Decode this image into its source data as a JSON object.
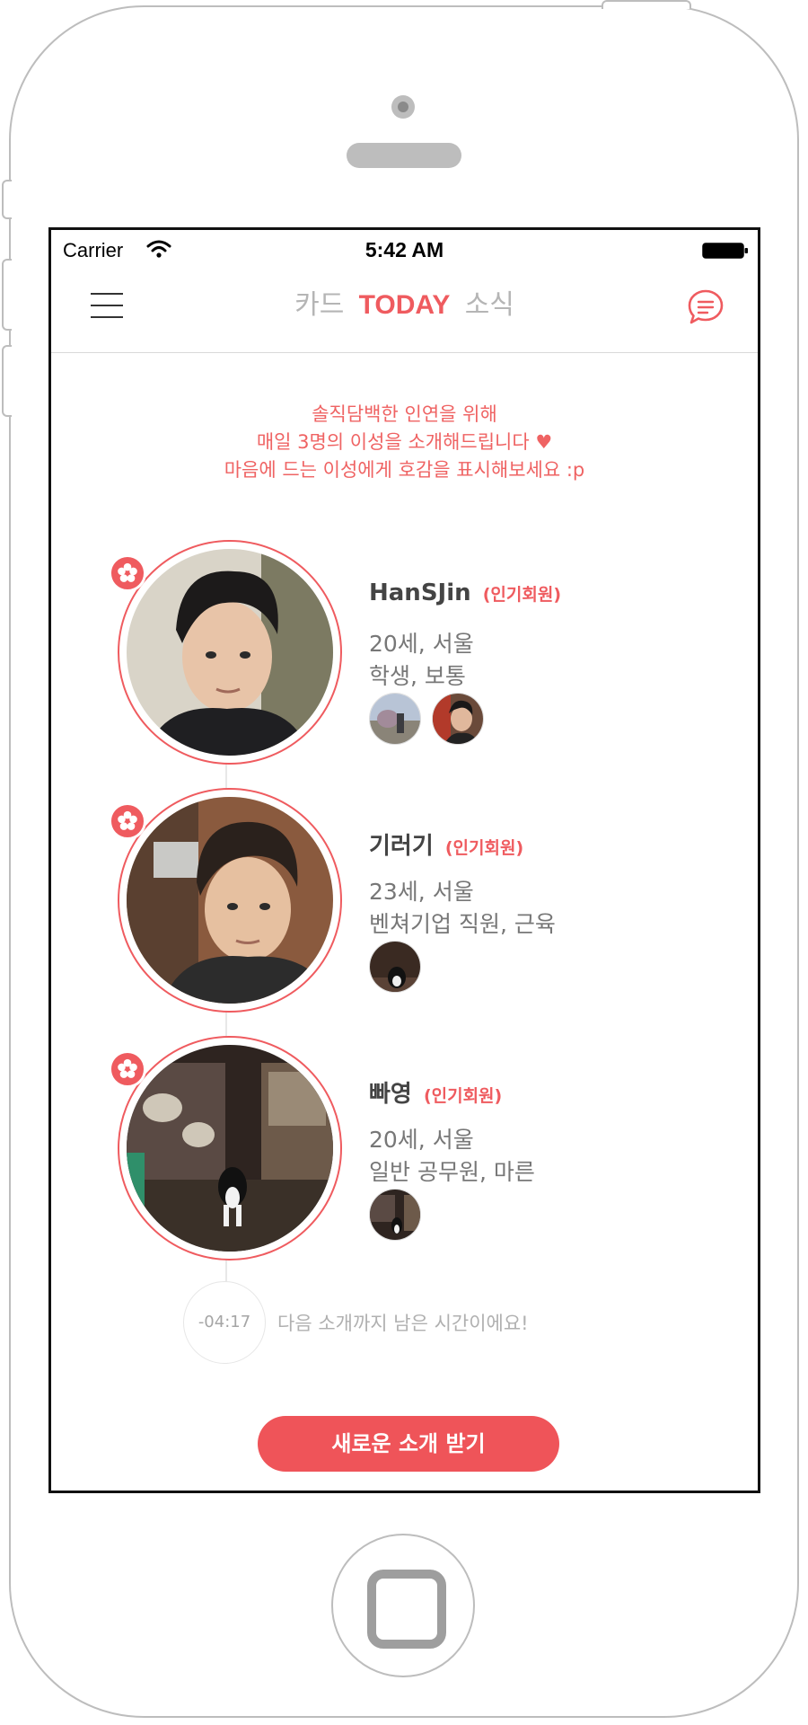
{
  "status_bar": {
    "carrier": "Carrier",
    "time": "5:42 AM",
    "icons": [
      "wifi-icon",
      "battery-icon"
    ]
  },
  "nav": {
    "menu_icon": "hamburger-menu-icon",
    "tabs": [
      {
        "label": "카드",
        "active": false
      },
      {
        "label": "TODAY",
        "active": true
      },
      {
        "label": "소식",
        "active": false
      }
    ],
    "chat_icon": "chat-bubble-icon"
  },
  "intro": {
    "line1": "솔직담백한 인연을 위해",
    "line2": "매일 3명의 이성을 소개해드립니다 ♥",
    "line3": "마음에 드는 이성에게 호감을 표시해보세요 :p"
  },
  "profiles": [
    {
      "name": "HanSJin",
      "tag": "(인기회원)",
      "age_location": "20세, 서울",
      "job_body": "학생, 보통",
      "badge_icon": "cherry-blossom-icon",
      "photos": 2
    },
    {
      "name": "기러기",
      "tag": "(인기회원)",
      "age_location": "23세, 서울",
      "job_body": "벤쳐기업 직원, 근육",
      "badge_icon": "cherry-blossom-icon",
      "photos": 1
    },
    {
      "name": "빠영",
      "tag": "(인기회원)",
      "age_location": "20세, 서울",
      "job_body": "일반 공무원, 마른",
      "badge_icon": "cherry-blossom-icon",
      "photos": 1
    }
  ],
  "countdown": {
    "value": "-04:17",
    "message": "다음 소개까지 남은 시간이에요!"
  },
  "action_button": {
    "label": "새로운 소개 받기"
  },
  "colors": {
    "accent": "#ef5b5f",
    "inactive_tab": "#b5b5b5",
    "body_text": "#777777"
  }
}
